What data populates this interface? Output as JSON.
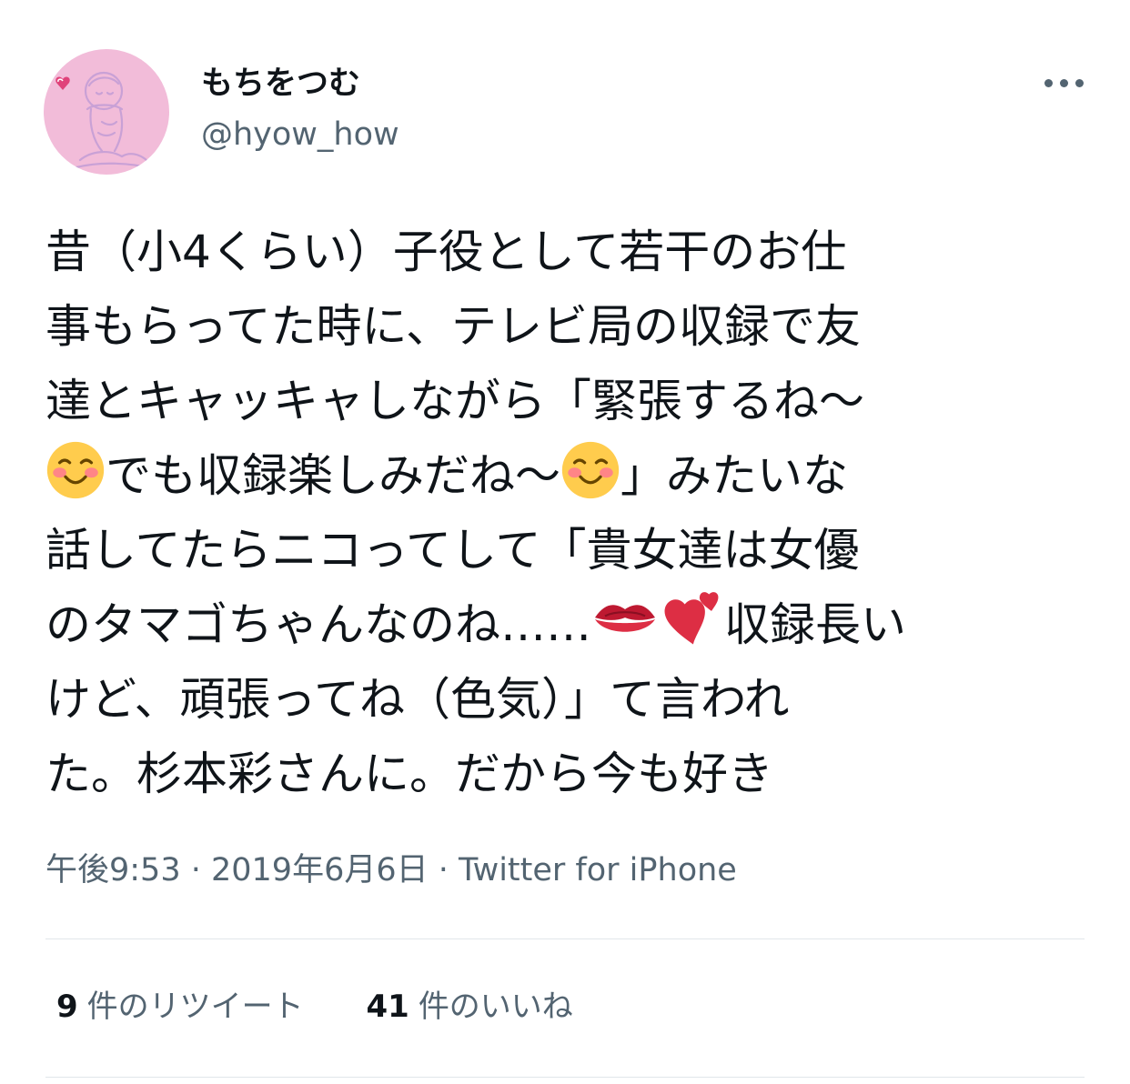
{
  "user": {
    "display_name": "もちをつむ",
    "handle": "@hyow_how",
    "avatar_icon": "illustrated-avatar"
  },
  "more_icon": "more-dots-icon",
  "tweet": {
    "lines": [
      [
        "昔（小4くらい）子役として若干のお仕"
      ],
      [
        "事もらってた時に、テレビ局の収録で友"
      ],
      [
        "達とキャッキャしながら「緊張するね〜"
      ],
      [
        {
          "emoji": "smiling-face-with-blush"
        },
        "でも収録楽しみだね〜",
        {
          "emoji": "smiling-face-with-blush"
        },
        "」みたいな"
      ],
      [
        "話してたらニコってして「貴女達は女優"
      ],
      [
        "のタマゴちゃんなのね……",
        {
          "emoji": "kiss-mark"
        },
        {
          "emoji": "two-hearts"
        },
        "収録長い"
      ],
      [
        "けど、頑張ってね（色気）」て言われ"
      ],
      [
        "た。杉本彩さんに。だから今も好き"
      ]
    ]
  },
  "meta": {
    "time": "午後9:53",
    "separator": " · ",
    "date": "2019年6月6日",
    "client": "Twitter for iPhone"
  },
  "stats": {
    "retweets": {
      "count": "9",
      "label": "件のリツイート"
    },
    "likes": {
      "count": "41",
      "label": "件のいいね"
    }
  },
  "colors": {
    "text": "#0f1419",
    "secondary": "#536471",
    "divider": "#e1e6ea",
    "avatar_bg": "#f2bcd9"
  }
}
